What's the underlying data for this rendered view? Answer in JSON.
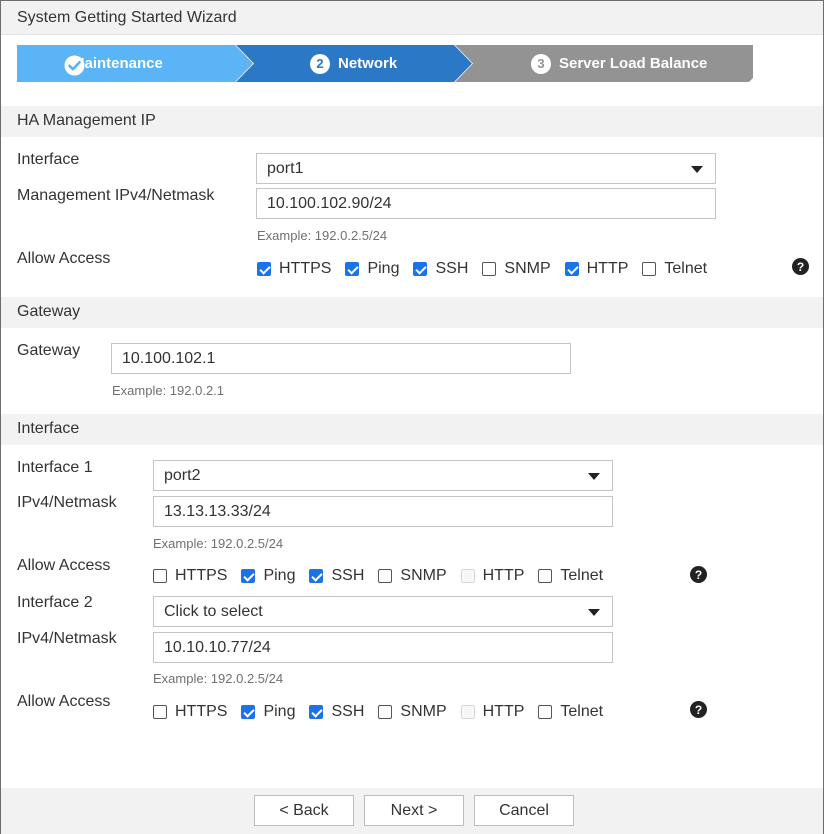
{
  "window": {
    "title": "System Getting Started Wizard"
  },
  "steps": [
    {
      "label": "Maintenance",
      "icon": "check-circle-icon",
      "state": "done",
      "color": "#5ab4f5"
    },
    {
      "label": "Network",
      "number": "2",
      "state": "active",
      "color": "#2a78c6"
    },
    {
      "label": "Server Load Balance",
      "number": "3",
      "state": "pending",
      "color": "#939393"
    }
  ],
  "ha": {
    "header": "HA Management IP",
    "interface_label": "Interface",
    "interface_value": "port1",
    "mgmt_label": "Management IPv4/Netmask",
    "mgmt_value": "10.100.102.90/24",
    "example": "Example: 192.0.2.5/24",
    "access_label": "Allow Access",
    "access": [
      {
        "label": "HTTPS",
        "checked": true
      },
      {
        "label": "Ping",
        "checked": true
      },
      {
        "label": "SSH",
        "checked": true
      },
      {
        "label": "SNMP",
        "checked": false
      },
      {
        "label": "HTTP",
        "checked": true
      },
      {
        "label": "Telnet",
        "checked": false
      }
    ],
    "help_icon": "question-circle-icon"
  },
  "gateway": {
    "header": "Gateway",
    "label": "Gateway",
    "value": "10.100.102.1",
    "example": "Example: 192.0.2.1"
  },
  "interface": {
    "header": "Interface",
    "if1_label": "Interface 1",
    "if1_value": "port2",
    "if1_ip_label": "IPv4/Netmask",
    "if1_ip_value": "13.13.13.33/24",
    "if1_example": "Example: 192.0.2.5/24",
    "if1_access_label": "Allow Access",
    "if1_access": [
      {
        "label": "HTTPS",
        "checked": false
      },
      {
        "label": "Ping",
        "checked": true
      },
      {
        "label": "SSH",
        "checked": true
      },
      {
        "label": "SNMP",
        "checked": false
      },
      {
        "label": "HTTP",
        "checked": false,
        "disabled": true
      },
      {
        "label": "Telnet",
        "checked": false
      }
    ],
    "if2_label": "Interface 2",
    "if2_value": "Click to select",
    "if2_ip_label": "IPv4/Netmask",
    "if2_ip_value": "10.10.10.77/24",
    "if2_example": "Example: 192.0.2.5/24",
    "if2_access_label": "Allow Access",
    "if2_access": [
      {
        "label": "HTTPS",
        "checked": false
      },
      {
        "label": "Ping",
        "checked": true
      },
      {
        "label": "SSH",
        "checked": true
      },
      {
        "label": "SNMP",
        "checked": false
      },
      {
        "label": "HTTP",
        "checked": false,
        "disabled": true
      },
      {
        "label": "Telnet",
        "checked": false
      }
    ]
  },
  "footer": {
    "back": "< Back",
    "next": "Next >",
    "cancel": "Cancel"
  }
}
